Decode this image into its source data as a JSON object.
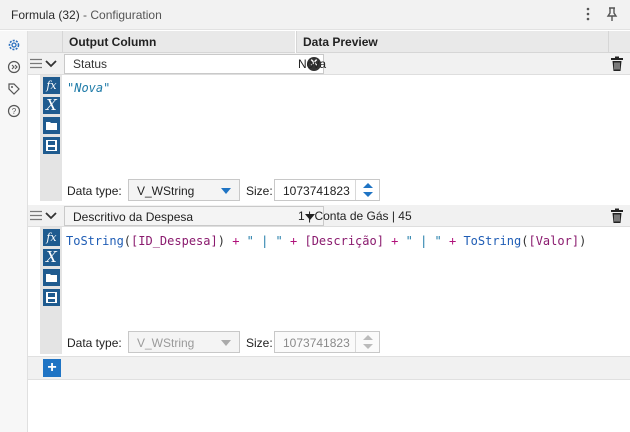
{
  "window": {
    "title": "Formula (32)",
    "subtitle": "- Configuration",
    "more_icon": "more-vertical-icon",
    "pin_icon": "pin-icon"
  },
  "sidebar": {
    "items": [
      {
        "icon": "gear-icon"
      },
      {
        "icon": "connections-icon"
      },
      {
        "icon": "tag-icon"
      },
      {
        "icon": "help-icon"
      }
    ]
  },
  "table": {
    "headers": {
      "output_column": "Output Column",
      "data_preview": "Data Preview"
    },
    "rows": [
      {
        "field_value": "Status",
        "preview": "Nova",
        "expression": "\"Nova\"",
        "data_type_label": "Data type:",
        "data_type": "V_WString",
        "size_label": "Size:",
        "size": "1073741823",
        "enabled": true
      },
      {
        "field_value": "Descritivo da Despesa",
        "preview": "1 | Conta de Gás | 45",
        "expression_tokens": [
          {
            "t": "ToString",
            "c": "fn"
          },
          {
            "t": "(",
            "c": "p"
          },
          {
            "t": "[ID_Despesa]",
            "c": "f"
          },
          {
            "t": ")",
            "c": "p"
          },
          {
            "t": " + ",
            "c": "op"
          },
          {
            "t": "\" | \"",
            "c": "s"
          },
          {
            "t": " + ",
            "c": "op"
          },
          {
            "t": "[Descrição]",
            "c": "f"
          },
          {
            "t": " + ",
            "c": "op"
          },
          {
            "t": "\" | \"",
            "c": "s"
          },
          {
            "t": " + ",
            "c": "op"
          },
          {
            "t": "ToString",
            "c": "fn"
          },
          {
            "t": "(",
            "c": "p"
          },
          {
            "t": "[Valor]",
            "c": "f"
          },
          {
            "t": ")",
            "c": "p"
          }
        ],
        "data_type_label": "Data type:",
        "data_type": "V_WString",
        "size_label": "Size:",
        "size": "1073741823",
        "enabled": false
      }
    ]
  },
  "colors": {
    "function": "#1f5db5",
    "field": "#8a1a6e",
    "string": "#1f7ba8",
    "operator": "#b0107a",
    "paren": "#333333",
    "accent": "#1f5b8f"
  },
  "add_button_label": "+"
}
